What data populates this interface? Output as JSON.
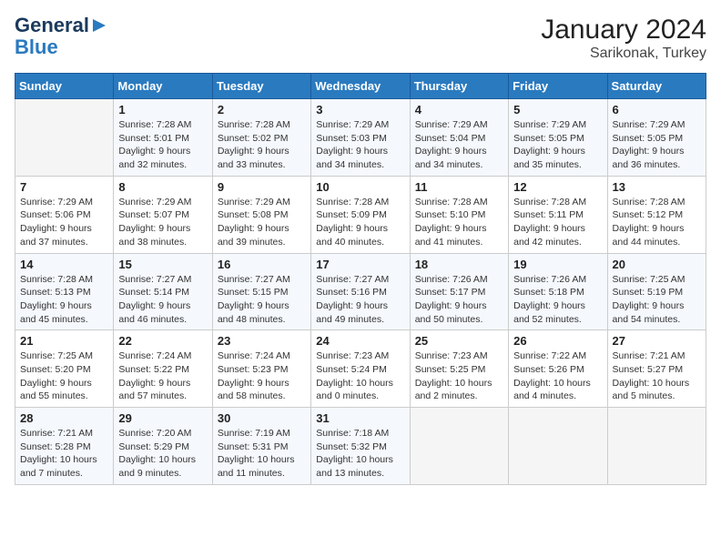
{
  "header": {
    "logo_line1": "General",
    "logo_line2": "Blue",
    "title": "January 2024",
    "subtitle": "Sarikonak, Turkey"
  },
  "calendar": {
    "days_of_week": [
      "Sunday",
      "Monday",
      "Tuesday",
      "Wednesday",
      "Thursday",
      "Friday",
      "Saturday"
    ],
    "weeks": [
      [
        {
          "day": "",
          "info": ""
        },
        {
          "day": "1",
          "info": "Sunrise: 7:28 AM\nSunset: 5:01 PM\nDaylight: 9 hours\nand 32 minutes."
        },
        {
          "day": "2",
          "info": "Sunrise: 7:28 AM\nSunset: 5:02 PM\nDaylight: 9 hours\nand 33 minutes."
        },
        {
          "day": "3",
          "info": "Sunrise: 7:29 AM\nSunset: 5:03 PM\nDaylight: 9 hours\nand 34 minutes."
        },
        {
          "day": "4",
          "info": "Sunrise: 7:29 AM\nSunset: 5:04 PM\nDaylight: 9 hours\nand 34 minutes."
        },
        {
          "day": "5",
          "info": "Sunrise: 7:29 AM\nSunset: 5:05 PM\nDaylight: 9 hours\nand 35 minutes."
        },
        {
          "day": "6",
          "info": "Sunrise: 7:29 AM\nSunset: 5:05 PM\nDaylight: 9 hours\nand 36 minutes."
        }
      ],
      [
        {
          "day": "7",
          "info": "Sunrise: 7:29 AM\nSunset: 5:06 PM\nDaylight: 9 hours\nand 37 minutes."
        },
        {
          "day": "8",
          "info": "Sunrise: 7:29 AM\nSunset: 5:07 PM\nDaylight: 9 hours\nand 38 minutes."
        },
        {
          "day": "9",
          "info": "Sunrise: 7:29 AM\nSunset: 5:08 PM\nDaylight: 9 hours\nand 39 minutes."
        },
        {
          "day": "10",
          "info": "Sunrise: 7:28 AM\nSunset: 5:09 PM\nDaylight: 9 hours\nand 40 minutes."
        },
        {
          "day": "11",
          "info": "Sunrise: 7:28 AM\nSunset: 5:10 PM\nDaylight: 9 hours\nand 41 minutes."
        },
        {
          "day": "12",
          "info": "Sunrise: 7:28 AM\nSunset: 5:11 PM\nDaylight: 9 hours\nand 42 minutes."
        },
        {
          "day": "13",
          "info": "Sunrise: 7:28 AM\nSunset: 5:12 PM\nDaylight: 9 hours\nand 44 minutes."
        }
      ],
      [
        {
          "day": "14",
          "info": "Sunrise: 7:28 AM\nSunset: 5:13 PM\nDaylight: 9 hours\nand 45 minutes."
        },
        {
          "day": "15",
          "info": "Sunrise: 7:27 AM\nSunset: 5:14 PM\nDaylight: 9 hours\nand 46 minutes."
        },
        {
          "day": "16",
          "info": "Sunrise: 7:27 AM\nSunset: 5:15 PM\nDaylight: 9 hours\nand 48 minutes."
        },
        {
          "day": "17",
          "info": "Sunrise: 7:27 AM\nSunset: 5:16 PM\nDaylight: 9 hours\nand 49 minutes."
        },
        {
          "day": "18",
          "info": "Sunrise: 7:26 AM\nSunset: 5:17 PM\nDaylight: 9 hours\nand 50 minutes."
        },
        {
          "day": "19",
          "info": "Sunrise: 7:26 AM\nSunset: 5:18 PM\nDaylight: 9 hours\nand 52 minutes."
        },
        {
          "day": "20",
          "info": "Sunrise: 7:25 AM\nSunset: 5:19 PM\nDaylight: 9 hours\nand 54 minutes."
        }
      ],
      [
        {
          "day": "21",
          "info": "Sunrise: 7:25 AM\nSunset: 5:20 PM\nDaylight: 9 hours\nand 55 minutes."
        },
        {
          "day": "22",
          "info": "Sunrise: 7:24 AM\nSunset: 5:22 PM\nDaylight: 9 hours\nand 57 minutes."
        },
        {
          "day": "23",
          "info": "Sunrise: 7:24 AM\nSunset: 5:23 PM\nDaylight: 9 hours\nand 58 minutes."
        },
        {
          "day": "24",
          "info": "Sunrise: 7:23 AM\nSunset: 5:24 PM\nDaylight: 10 hours\nand 0 minutes."
        },
        {
          "day": "25",
          "info": "Sunrise: 7:23 AM\nSunset: 5:25 PM\nDaylight: 10 hours\nand 2 minutes."
        },
        {
          "day": "26",
          "info": "Sunrise: 7:22 AM\nSunset: 5:26 PM\nDaylight: 10 hours\nand 4 minutes."
        },
        {
          "day": "27",
          "info": "Sunrise: 7:21 AM\nSunset: 5:27 PM\nDaylight: 10 hours\nand 5 minutes."
        }
      ],
      [
        {
          "day": "28",
          "info": "Sunrise: 7:21 AM\nSunset: 5:28 PM\nDaylight: 10 hours\nand 7 minutes."
        },
        {
          "day": "29",
          "info": "Sunrise: 7:20 AM\nSunset: 5:29 PM\nDaylight: 10 hours\nand 9 minutes."
        },
        {
          "day": "30",
          "info": "Sunrise: 7:19 AM\nSunset: 5:31 PM\nDaylight: 10 hours\nand 11 minutes."
        },
        {
          "day": "31",
          "info": "Sunrise: 7:18 AM\nSunset: 5:32 PM\nDaylight: 10 hours\nand 13 minutes."
        },
        {
          "day": "",
          "info": ""
        },
        {
          "day": "",
          "info": ""
        },
        {
          "day": "",
          "info": ""
        }
      ]
    ]
  }
}
